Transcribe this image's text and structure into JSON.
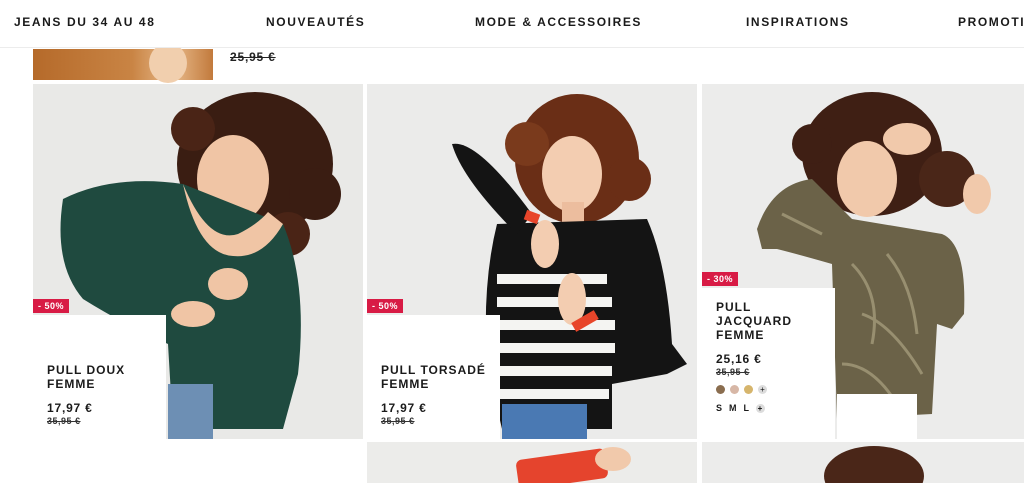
{
  "nav": {
    "items": [
      "JEANS DU 34 AU 48",
      "NOUVEAUTÉS",
      "MODE & ACCESSOIRES",
      "INSPIRATIONS",
      "PROMOTIONS"
    ]
  },
  "previous_row": {
    "old_price": "25,95 €"
  },
  "products": [
    {
      "badge": "- 50%",
      "name": "PULL DOUX FEMME",
      "price": "17,97 €",
      "old_price": "35,95 €",
      "color": "#1f4a3f"
    },
    {
      "badge": "- 50%",
      "name": "PULL TORSADÉ FEMME",
      "price": "17,97 €",
      "old_price": "35,95 €",
      "color": "#141414"
    },
    {
      "badge": "- 30%",
      "name": "PULL JACQUARD FEMME",
      "price": "25,16 €",
      "old_price": "35,95 €",
      "color": "#6b6248",
      "swatches": [
        "#8a6d4f",
        "#d7b7a6",
        "#d6b56c"
      ],
      "more_colors_icon": "plus-icon",
      "sizes": [
        "S",
        "M",
        "L"
      ],
      "more_sizes_icon": "plus-icon"
    }
  ],
  "accent": {
    "badge": "#d81b45"
  }
}
